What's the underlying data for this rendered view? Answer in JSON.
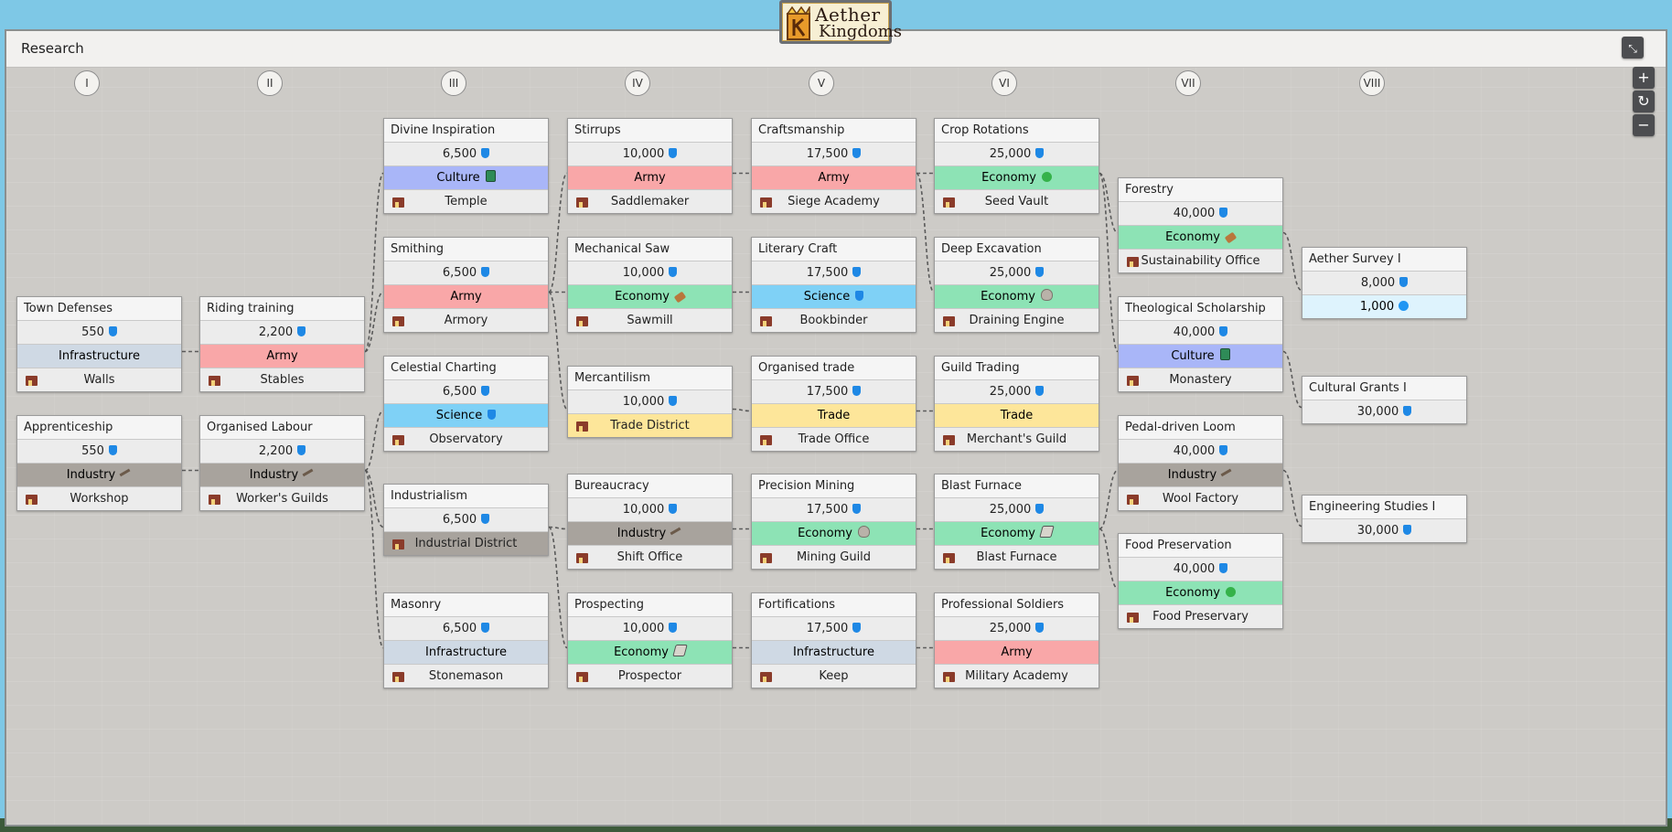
{
  "header": {
    "title": "Research",
    "collapse_icon": "collapse-arrows-icon"
  },
  "logo": {
    "line1": "Aether",
    "line2": "Kingdoms"
  },
  "zoom_controls": {
    "plus": "+",
    "reset": "↻",
    "minus": "−"
  },
  "columns": [
    "I",
    "II",
    "III",
    "IV",
    "V",
    "VI",
    "VII",
    "VIII"
  ],
  "colors": {
    "Infrastructure": "#cfd9e4",
    "Army": "#f9a7a8",
    "Industry": "#a8a39d",
    "Culture": "#a9b6f8",
    "Science": "#7fd1f6",
    "Economy": "#8de3b5",
    "Trade": "#fde69a",
    "Aether": "#def3fd"
  },
  "techs": [
    {
      "id": "town-defenses",
      "col": 0,
      "row": 3,
      "name": "Town Defenses",
      "cost": "550",
      "category": "Infrastructure",
      "icon": "",
      "building": "Walls"
    },
    {
      "id": "apprenticeship",
      "col": 0,
      "row": 4,
      "name": "Apprenticeship",
      "cost": "550",
      "category": "Industry",
      "icon": "hammer",
      "building": "Workshop"
    },
    {
      "id": "riding-training",
      "col": 1,
      "row": 3,
      "name": "Riding training",
      "cost": "2,200",
      "category": "Army",
      "icon": "",
      "building": "Stables"
    },
    {
      "id": "organised-labour",
      "col": 1,
      "row": 4,
      "name": "Organised Labour",
      "cost": "2,200",
      "category": "Industry",
      "icon": "hammer",
      "building": "Worker's Guilds"
    },
    {
      "id": "divine-inspiration",
      "col": 2,
      "row": 1,
      "name": "Divine Inspiration",
      "cost": "6,500",
      "category": "Culture",
      "icon": "book",
      "building": "Temple"
    },
    {
      "id": "smithing",
      "col": 2,
      "row": 2,
      "name": "Smithing",
      "cost": "6,500",
      "category": "Army",
      "icon": "",
      "building": "Armory"
    },
    {
      "id": "celestial-charting",
      "col": 2,
      "row": 3,
      "name": "Celestial Charting",
      "cost": "6,500",
      "category": "Science",
      "icon": "flask",
      "building": "Observatory"
    },
    {
      "id": "industrialism",
      "col": 2,
      "row": 4,
      "name": "Industrialism",
      "cost": "6,500",
      "category": "Industry",
      "icon": "",
      "building": "Industrial District",
      "merged": true
    },
    {
      "id": "masonry",
      "col": 2,
      "row": 5,
      "name": "Masonry",
      "cost": "6,500",
      "category": "Infrastructure",
      "icon": "",
      "building": "Stonemason"
    },
    {
      "id": "stirrups",
      "col": 3,
      "row": 1,
      "name": "Stirrups",
      "cost": "10,000",
      "category": "Army",
      "icon": "",
      "building": "Saddlemaker"
    },
    {
      "id": "mechanical-saw",
      "col": 3,
      "row": 2,
      "name": "Mechanical Saw",
      "cost": "10,000",
      "category": "Economy",
      "icon": "log",
      "building": "Sawmill"
    },
    {
      "id": "mercantilism",
      "col": 3,
      "row": 3,
      "name": "Mercantilism",
      "cost": "10,000",
      "category": "Trade",
      "icon": "",
      "building": "Trade District",
      "merged": true
    },
    {
      "id": "bureaucracy",
      "col": 3,
      "row": 4,
      "name": "Bureaucracy",
      "cost": "10,000",
      "category": "Industry",
      "icon": "hammer",
      "building": "Shift Office"
    },
    {
      "id": "prospecting",
      "col": 3,
      "row": 5,
      "name": "Prospecting",
      "cost": "10,000",
      "category": "Economy",
      "icon": "scroll",
      "building": "Prospector"
    },
    {
      "id": "craftsmanship",
      "col": 4,
      "row": 1,
      "name": "Craftsmanship",
      "cost": "17,500",
      "category": "Army",
      "icon": "",
      "building": "Siege Academy"
    },
    {
      "id": "literary-craft",
      "col": 4,
      "row": 2,
      "name": "Literary Craft",
      "cost": "17,500",
      "category": "Science",
      "icon": "flask",
      "building": "Bookbinder"
    },
    {
      "id": "organised-trade",
      "col": 4,
      "row": 3,
      "name": "Organised trade",
      "cost": "17,500",
      "category": "Trade",
      "icon": "",
      "building": "Trade Office"
    },
    {
      "id": "precision-mining",
      "col": 4,
      "row": 4,
      "name": "Precision Mining",
      "cost": "17,500",
      "category": "Economy",
      "icon": "stone",
      "building": "Mining Guild"
    },
    {
      "id": "fortifications",
      "col": 4,
      "row": 5,
      "name": "Fortifications",
      "cost": "17,500",
      "category": "Infrastructure",
      "icon": "",
      "building": "Keep"
    },
    {
      "id": "crop-rotations",
      "col": 5,
      "row": 1,
      "name": "Crop Rotations",
      "cost": "25,000",
      "category": "Economy",
      "icon": "apple",
      "building": "Seed Vault"
    },
    {
      "id": "deep-excavation",
      "col": 5,
      "row": 2,
      "name": "Deep Excavation",
      "cost": "25,000",
      "category": "Economy",
      "icon": "stone",
      "building": "Draining Engine"
    },
    {
      "id": "guild-trading",
      "col": 5,
      "row": 3,
      "name": "Guild Trading",
      "cost": "25,000",
      "category": "Trade",
      "icon": "",
      "building": "Merchant's Guild"
    },
    {
      "id": "blast-furnace",
      "col": 5,
      "row": 4,
      "name": "Blast Furnace",
      "cost": "25,000",
      "category": "Economy",
      "icon": "scroll",
      "building": "Blast Furnace"
    },
    {
      "id": "professional-soldiers",
      "col": 5,
      "row": 5,
      "name": "Professional Soldiers",
      "cost": "25,000",
      "category": "Army",
      "icon": "",
      "building": "Military Academy"
    },
    {
      "id": "forestry",
      "col": 6,
      "row": 1.5,
      "name": "Forestry",
      "cost": "40,000",
      "category": "Economy",
      "icon": "log",
      "building": "Sustainability Office"
    },
    {
      "id": "theological-scholarship",
      "col": 6,
      "row": 3,
      "name": "Theological Scholarship",
      "cost": "40,000",
      "category": "Culture",
      "icon": "book",
      "building": "Monastery"
    },
    {
      "id": "pedal-driven-loom",
      "col": 6,
      "row": 4,
      "name": "Pedal-driven Loom",
      "cost": "40,000",
      "category": "Industry",
      "icon": "hammer",
      "building": "Wool Factory"
    },
    {
      "id": "food-preservation",
      "col": 6,
      "row": 5,
      "name": "Food Preservation",
      "cost": "40,000",
      "category": "Economy",
      "icon": "apple",
      "building": "Food Preservary"
    },
    {
      "id": "aether-survey-i",
      "col": 7,
      "row": 2.2,
      "name": "Aether Survey I",
      "cost": "8,000",
      "aether": "1,000"
    },
    {
      "id": "cultural-grants-i",
      "col": 7,
      "row": 3.3,
      "name": "Cultural Grants I",
      "cost": "30,000"
    },
    {
      "id": "engineering-studies-i",
      "col": 7,
      "row": 4.3,
      "name": "Engineering Studies I",
      "cost": "30,000"
    }
  ],
  "links": [
    [
      "town-defenses",
      "riding-training"
    ],
    [
      "apprenticeship",
      "organised-labour"
    ],
    [
      "riding-training",
      "divine-inspiration"
    ],
    [
      "riding-training",
      "smithing"
    ],
    [
      "organised-labour",
      "celestial-charting"
    ],
    [
      "organised-labour",
      "industrialism"
    ],
    [
      "organised-labour",
      "masonry"
    ],
    [
      "smithing",
      "stirrups"
    ],
    [
      "smithing",
      "mechanical-saw"
    ],
    [
      "smithing",
      "mercantilism"
    ],
    [
      "industrialism",
      "bureaucracy"
    ],
    [
      "industrialism",
      "prospecting"
    ],
    [
      "stirrups",
      "craftsmanship"
    ],
    [
      "mechanical-saw",
      "literary-craft"
    ],
    [
      "mercantilism",
      "organised-trade"
    ],
    [
      "bureaucracy",
      "precision-mining"
    ],
    [
      "prospecting",
      "fortifications"
    ],
    [
      "craftsmanship",
      "crop-rotations"
    ],
    [
      "craftsmanship",
      "deep-excavation"
    ],
    [
      "organised-trade",
      "guild-trading"
    ],
    [
      "precision-mining",
      "blast-furnace"
    ],
    [
      "fortifications",
      "professional-soldiers"
    ],
    [
      "crop-rotations",
      "forestry"
    ],
    [
      "crop-rotations",
      "theological-scholarship"
    ],
    [
      "blast-furnace",
      "pedal-driven-loom"
    ],
    [
      "blast-furnace",
      "food-preservation"
    ],
    [
      "forestry",
      "aether-survey-i"
    ],
    [
      "theological-scholarship",
      "cultural-grants-i"
    ],
    [
      "pedal-driven-loom",
      "engineering-studies-i"
    ]
  ]
}
